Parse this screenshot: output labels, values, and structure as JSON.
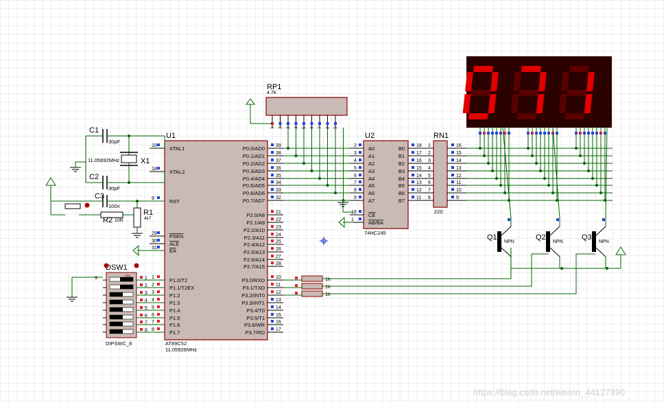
{
  "colors": {
    "grid": "#d9d9d9",
    "chip_fill": "#c8b9b4",
    "chip_border": "#8b0000",
    "wire": "#006400",
    "pin_blue": "#2145d6",
    "pin_red": "#e0202a",
    "seg_bg": "#300000",
    "seg_on": "#e00000",
    "seg_off": "#5a0000"
  },
  "u1": {
    "ref": "U1",
    "part": "AT89C52",
    "freq": "11.05926MHz",
    "left_pins": [
      {
        "num": "19",
        "name": "XTAL1"
      },
      {
        "num": "18",
        "name": "XTAL2"
      },
      {
        "num": "9",
        "name": "RST"
      },
      {
        "num": "29",
        "name": "PSEN"
      },
      {
        "num": "30",
        "name": "ALE"
      },
      {
        "num": "31",
        "name": "EA"
      },
      {
        "num": "1",
        "name": "P1.0/T2"
      },
      {
        "num": "2",
        "name": "P1.1/T2EX"
      },
      {
        "num": "3",
        "name": "P1.2"
      },
      {
        "num": "4",
        "name": "P1.3"
      },
      {
        "num": "5",
        "name": "P1.4"
      },
      {
        "num": "6",
        "name": "P1.5"
      },
      {
        "num": "7",
        "name": "P1.6"
      },
      {
        "num": "8",
        "name": "P1.7"
      }
    ],
    "right_pins": [
      {
        "num": "39",
        "name": "P0.0/AD0"
      },
      {
        "num": "38",
        "name": "P0.1/AD1"
      },
      {
        "num": "37",
        "name": "P0.2/AD2"
      },
      {
        "num": "36",
        "name": "P0.3/AD3"
      },
      {
        "num": "35",
        "name": "P0.4/AD4"
      },
      {
        "num": "34",
        "name": "P0.5/AD5"
      },
      {
        "num": "33",
        "name": "P0.6/AD6"
      },
      {
        "num": "32",
        "name": "P0.7/AD7"
      },
      {
        "num": "21",
        "name": "P2.0/A8"
      },
      {
        "num": "22",
        "name": "P2.1/A9"
      },
      {
        "num": "23",
        "name": "P2.2/A10"
      },
      {
        "num": "24",
        "name": "P2.3/A11"
      },
      {
        "num": "25",
        "name": "P2.4/A12"
      },
      {
        "num": "26",
        "name": "P2.5/A13"
      },
      {
        "num": "27",
        "name": "P2.6/A14"
      },
      {
        "num": "28",
        "name": "P2.7/A15"
      },
      {
        "num": "10",
        "name": "P3.0/RXD"
      },
      {
        "num": "11",
        "name": "P3.1/TXD"
      },
      {
        "num": "12",
        "name": "P3.2/INT0"
      },
      {
        "num": "13",
        "name": "P3.3/INT1"
      },
      {
        "num": "14",
        "name": "P3.4/T0"
      },
      {
        "num": "15",
        "name": "P3.5/T1"
      },
      {
        "num": "16",
        "name": "P3.6/WR"
      },
      {
        "num": "17",
        "name": "P3.7/RD"
      }
    ]
  },
  "u2": {
    "ref": "U2",
    "part": "74HC245",
    "a_pins": [
      {
        "num": "2",
        "name": "A0"
      },
      {
        "num": "3",
        "name": "A1"
      },
      {
        "num": "4",
        "name": "A2"
      },
      {
        "num": "5",
        "name": "A3"
      },
      {
        "num": "6",
        "name": "A4"
      },
      {
        "num": "7",
        "name": "A5"
      },
      {
        "num": "8",
        "name": "A6"
      },
      {
        "num": "9",
        "name": "A7"
      }
    ],
    "ctrl_pins": [
      {
        "num": "19",
        "name": "CE"
      },
      {
        "num": "1",
        "name": "AB/BA"
      }
    ],
    "b_pins": [
      {
        "num": "18",
        "name": "B0"
      },
      {
        "num": "17",
        "name": "B1"
      },
      {
        "num": "16",
        "name": "B2"
      },
      {
        "num": "15",
        "name": "B3"
      },
      {
        "num": "14",
        "name": "B4"
      },
      {
        "num": "13",
        "name": "B5"
      },
      {
        "num": "12",
        "name": "B6"
      },
      {
        "num": "11",
        "name": "B7"
      }
    ]
  },
  "rn1": {
    "ref": "RN1",
    "value": "220",
    "left_pins": [
      "1",
      "2",
      "3",
      "4",
      "5",
      "6",
      "7",
      "8"
    ],
    "right_pins": [
      "16",
      "15",
      "14",
      "13",
      "12",
      "11",
      "10",
      "9"
    ]
  },
  "rp1": {
    "ref": "RP1",
    "value": "4.7K",
    "pins": [
      "1",
      "2",
      "3",
      "4",
      "5",
      "6",
      "7",
      "8",
      "9"
    ]
  },
  "passives": {
    "c1": {
      "ref": "C1",
      "value": "30pF"
    },
    "c2": {
      "ref": "C2",
      "value": "30pF"
    },
    "c3": {
      "ref": "C3",
      "value": "100n"
    },
    "x1": {
      "ref": "X1",
      "value": "11.05692MHz"
    },
    "r1": {
      "ref": "R1",
      "value": "4k7"
    },
    "r2": {
      "ref": "R2",
      "value": "10R"
    },
    "series_res": [
      "1k",
      "1k",
      "1k"
    ]
  },
  "transistors": [
    {
      "ref": "Q1",
      "type": "NPN"
    },
    {
      "ref": "Q2",
      "type": "NPN"
    },
    {
      "ref": "Q3",
      "type": "NPN"
    }
  ],
  "dipsw": {
    "ref": "DSW1",
    "part": "DIPSWC_8",
    "header_on": "ON",
    "pin_left": "9",
    "pins_left": [
      "1",
      "2",
      "3",
      "4",
      "5",
      "6",
      "7",
      "8"
    ],
    "pins_right": [
      "16",
      "15",
      "14",
      "13",
      "12",
      "11",
      "10",
      "9"
    ],
    "states": [
      1,
      1,
      0,
      0,
      0,
      0,
      0,
      0
    ]
  },
  "display": {
    "digits": [
      {
        "char": "0",
        "segments": [
          1,
          1,
          1,
          1,
          1,
          1,
          0
        ]
      },
      {
        "char": "7",
        "segments": [
          1,
          1,
          1,
          0,
          0,
          0,
          0
        ]
      },
      {
        "char": "1",
        "segments": [
          0,
          1,
          1,
          0,
          0,
          0,
          0
        ]
      }
    ]
  },
  "watermark": "https://blog.csdn.net/weixin_44127390"
}
